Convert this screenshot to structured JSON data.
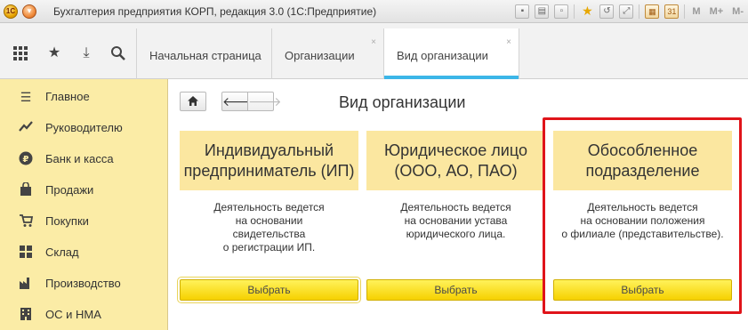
{
  "titlebar": {
    "app_logo": "1С",
    "menu_icon": "chevron-down-icon",
    "title": "Бухгалтерия предприятия КОРП, редакция 3.0  (1С:Предприятие)",
    "m_labels": [
      "M",
      "M+",
      "M-"
    ]
  },
  "tabs": [
    {
      "label": "Начальная страница",
      "closable": false,
      "active": false
    },
    {
      "label": "Организации",
      "closable": true,
      "active": false
    },
    {
      "label": "Вид организации",
      "closable": true,
      "active": true
    }
  ],
  "close_glyph": "×",
  "sidebar": {
    "items": [
      {
        "label": "Главное",
        "icon": "menu-lines-icon"
      },
      {
        "label": "Руководителю",
        "icon": "trend-icon"
      },
      {
        "label": "Банк и касса",
        "icon": "ruble-coin-icon"
      },
      {
        "label": "Продажи",
        "icon": "shopping-bag-icon"
      },
      {
        "label": "Покупки",
        "icon": "cart-icon"
      },
      {
        "label": "Склад",
        "icon": "warehouse-grid-icon"
      },
      {
        "label": "Производство",
        "icon": "factory-icon"
      },
      {
        "label": "ОС и НМА",
        "icon": "building-icon"
      }
    ]
  },
  "main": {
    "title": "Вид организации",
    "cards": [
      {
        "heading_lines": [
          "Индивидуальный",
          "предприниматель (ИП)"
        ],
        "desc_lines": [
          "Деятельность ведется",
          "на основании",
          "свидетельства",
          "о регистрации ИП."
        ],
        "button": "Выбрать"
      },
      {
        "heading_lines": [
          "Юридическое лицо",
          "(ООО, АО, ПАО)"
        ],
        "desc_lines": [
          "Деятельность ведется",
          "на основании устава",
          "юридического лица."
        ],
        "button": "Выбрать"
      },
      {
        "heading_lines": [
          "Обособленное",
          "подразделение"
        ],
        "desc_lines": [
          "Деятельность ведется",
          "на основании положения",
          "о филиале (представительстве)."
        ],
        "button": "Выбрать"
      }
    ]
  },
  "colors": {
    "sidebar_bg": "#fbeca6",
    "card_head_bg": "#fbe7a0",
    "button_yellow": "#f6d100",
    "active_tab_accent": "#3cb6e8",
    "highlight_red": "#e0141a"
  }
}
